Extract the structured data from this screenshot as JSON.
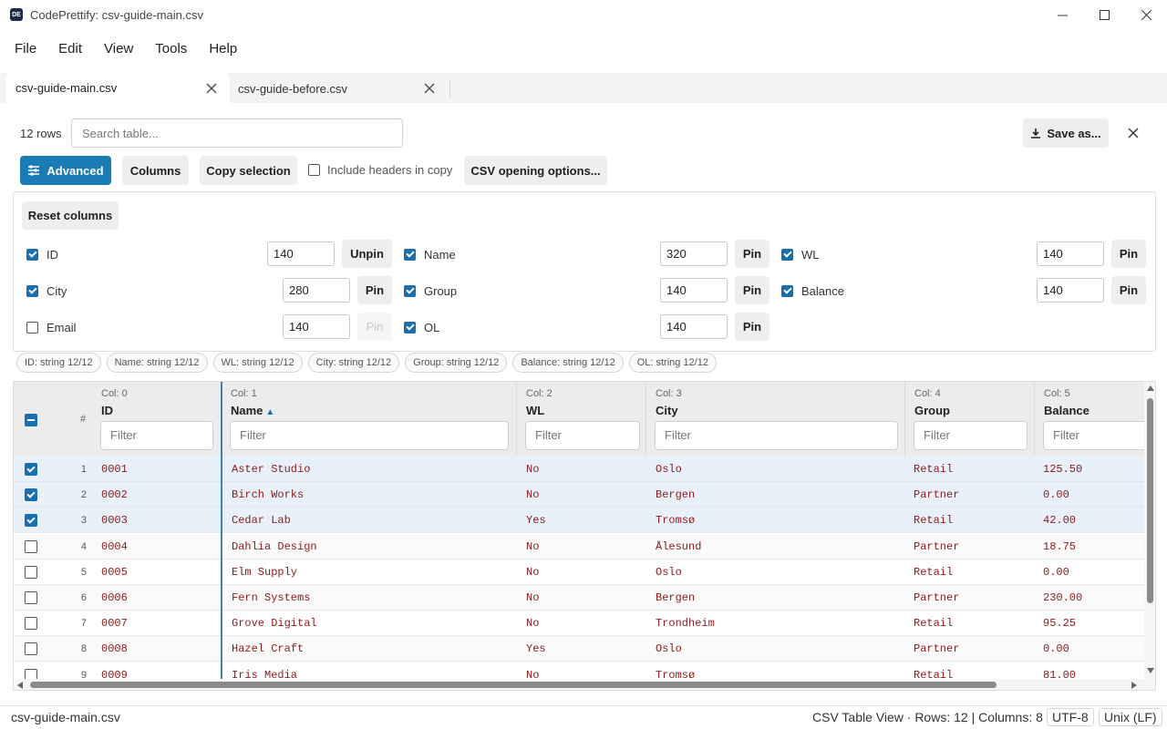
{
  "window": {
    "title": "CodePrettify: csv-guide-main.csv",
    "icon_text": "DE"
  },
  "menu": [
    "File",
    "Edit",
    "View",
    "Tools",
    "Help"
  ],
  "tabs": [
    {
      "label": "csv-guide-main.csv",
      "active": true
    },
    {
      "label": "csv-guide-before.csv",
      "active": false
    }
  ],
  "toolbar": {
    "row_count": "12 rows",
    "search_placeholder": "Search table...",
    "save_as": "Save as...",
    "advanced": "Advanced",
    "columns": "Columns",
    "copy_selection": "Copy selection",
    "include_headers": "Include headers in copy",
    "csv_options": "CSV opening options..."
  },
  "column_panel": {
    "reset": "Reset columns",
    "options": [
      {
        "name": "ID",
        "checked": true,
        "width": "140",
        "pin": "Unpin",
        "pin_disabled": false
      },
      {
        "name": "Name",
        "checked": true,
        "width": "320",
        "pin": "Pin",
        "pin_disabled": false
      },
      {
        "name": "WL",
        "checked": true,
        "width": "140",
        "pin": "Pin",
        "pin_disabled": false
      },
      {
        "name": "City",
        "checked": true,
        "width": "280",
        "pin": "Pin",
        "pin_disabled": false
      },
      {
        "name": "Group",
        "checked": true,
        "width": "140",
        "pin": "Pin",
        "pin_disabled": false
      },
      {
        "name": "Balance",
        "checked": true,
        "width": "140",
        "pin": "Pin",
        "pin_disabled": false
      },
      {
        "name": "Email",
        "checked": false,
        "width": "140",
        "pin": "Pin",
        "pin_disabled": true
      },
      {
        "name": "OL",
        "checked": true,
        "width": "140",
        "pin": "Pin",
        "pin_disabled": false
      }
    ]
  },
  "type_chips": [
    "ID: string 12/12",
    "Name: string 12/12",
    "WL: string 12/12",
    "City: string 12/12",
    "Group: string 12/12",
    "Balance: string 12/12",
    "OL: string 12/12"
  ],
  "grid": {
    "row_header": "#",
    "filter_placeholder": "Filter",
    "columns": [
      {
        "col": "Col: 0",
        "name": "ID",
        "sorted": false
      },
      {
        "col": "Col: 1",
        "name": "Name",
        "sorted": true,
        "sort_glyph": "▲"
      },
      {
        "col": "Col: 2",
        "name": "WL",
        "sorted": false
      },
      {
        "col": "Col: 3",
        "name": "City",
        "sorted": false
      },
      {
        "col": "Col: 4",
        "name": "Group",
        "sorted": false
      },
      {
        "col": "Col: 5",
        "name": "Balance",
        "sorted": false
      }
    ],
    "rows": [
      {
        "n": "1",
        "selected": true,
        "cells": [
          "0001",
          "Aster Studio",
          "No",
          "Oslo",
          "Retail",
          "125.50"
        ]
      },
      {
        "n": "2",
        "selected": true,
        "cells": [
          "0002",
          "Birch Works",
          "No",
          "Bergen",
          "Partner",
          "0.00"
        ]
      },
      {
        "n": "3",
        "selected": true,
        "cells": [
          "0003",
          "Cedar Lab",
          "Yes",
          "Tromsø",
          "Retail",
          "42.00"
        ]
      },
      {
        "n": "4",
        "selected": false,
        "cells": [
          "0004",
          "Dahlia Design",
          "No",
          "Ålesund",
          "Partner",
          "18.75"
        ]
      },
      {
        "n": "5",
        "selected": false,
        "cells": [
          "0005",
          "Elm Supply",
          "No",
          "Oslo",
          "Retail",
          "0.00"
        ]
      },
      {
        "n": "6",
        "selected": false,
        "cells": [
          "0006",
          "Fern Systems",
          "No",
          "Bergen",
          "Partner",
          "230.00"
        ]
      },
      {
        "n": "7",
        "selected": false,
        "cells": [
          "0007",
          "Grove Digital",
          "No",
          "Trondheim",
          "Retail",
          "95.25"
        ]
      },
      {
        "n": "8",
        "selected": false,
        "cells": [
          "0008",
          "Hazel Craft",
          "Yes",
          "Oslo",
          "Partner",
          "0.00"
        ]
      },
      {
        "n": "9",
        "selected": false,
        "cells": [
          "0009",
          "Iris Media",
          "No",
          "Tromsø",
          "Retail",
          "81.00"
        ]
      }
    ]
  },
  "status": {
    "file": "csv-guide-main.csv",
    "info": "CSV Table View · Rows: 12  |  Columns: 8",
    "encoding": "UTF-8",
    "eol": "Unix (LF)"
  },
  "colors": {
    "accent": "#1a7bb5",
    "cell_text": "#8b1a1a",
    "selected_row": "#e8f1fa"
  }
}
